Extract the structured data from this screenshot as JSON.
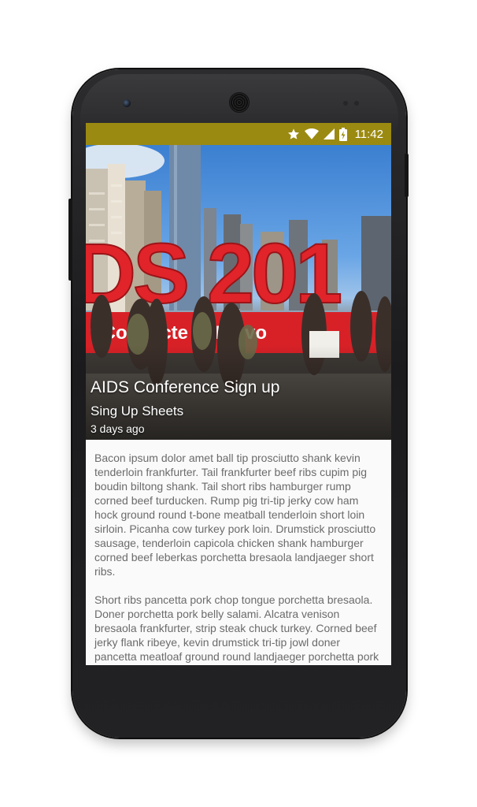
{
  "status_bar": {
    "time": "11:42",
    "icons": [
      "star-icon",
      "wifi-icon",
      "signal-icon",
      "battery-charging-icon"
    ],
    "color": "#9b8a11"
  },
  "article": {
    "title": "AIDS Conference Sign up",
    "subtitle": "Sing Up Sheets",
    "date": "3 days ago",
    "image_text": [
      "DS 201",
      "t Connecte    in Re    vo"
    ],
    "paragraphs": [
      "Bacon ipsum dolor amet ball tip prosciutto shank kevin tenderloin frankfurter. Tail frankfurter beef ribs cupim pig boudin biltong shank. Tail short ribs hamburger rump corned beef turducken. Rump pig tri-tip jerky cow ham hock ground round t-bone meatball tenderloin short loin sirloin. Picanha cow turkey pork loin. Drumstick prosciutto sausage, tenderloin capicola chicken shank hamburger corned beef leberkas porchetta bresaola landjaeger short ribs.",
      "Short ribs pancetta pork chop tongue porchetta bresaola. Doner porchetta pork belly salami. Alcatra venison bresaola frankfurter, strip steak chuck turkey. Corned beef jerky flank ribeye, kevin drumstick tri-tip jowl doner pancetta meatloaf ground round landjaeger porchetta pork loin. Short loin chuck tri-tip"
    ]
  }
}
